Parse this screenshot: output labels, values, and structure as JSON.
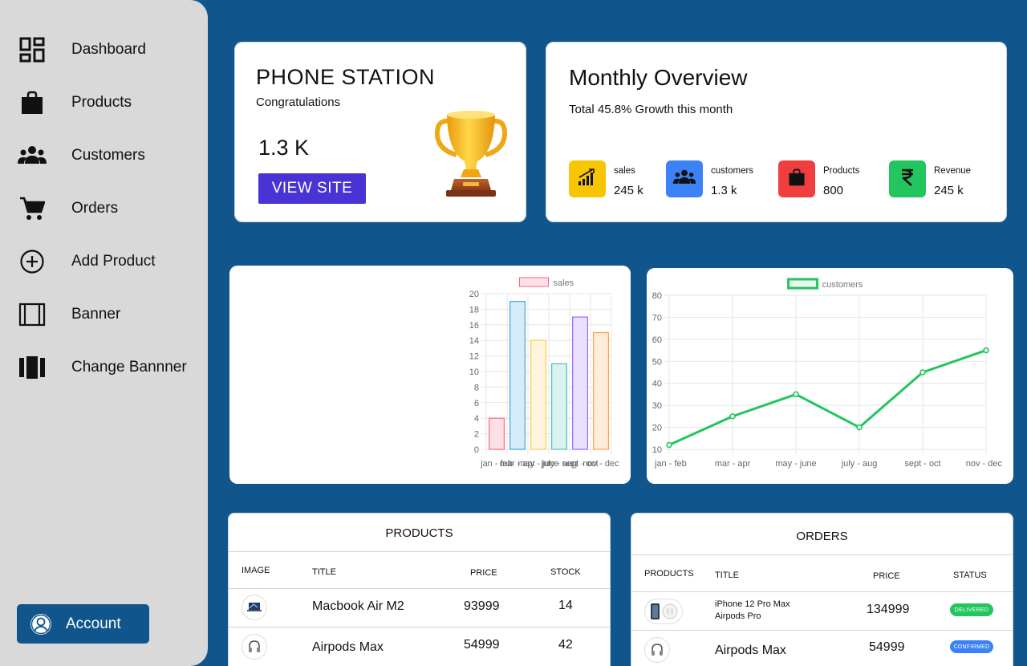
{
  "sidebar": {
    "items": [
      {
        "label": "Dashboard",
        "icon": "dashboard-icon"
      },
      {
        "label": "Products",
        "icon": "bag-icon"
      },
      {
        "label": "Customers",
        "icon": "users-icon"
      },
      {
        "label": "Orders",
        "icon": "cart-icon"
      },
      {
        "label": "Add Product",
        "icon": "plus-circle-icon"
      },
      {
        "label": "Banner",
        "icon": "banner-icon"
      },
      {
        "label": "Change Bannner",
        "icon": "change-banner-icon"
      }
    ],
    "account_label": "Account"
  },
  "welcome": {
    "title": "PHONE STATION",
    "subtitle": "Congratulations",
    "value": "1.3 K",
    "button_label": "VIEW SITE"
  },
  "overview": {
    "title": "Monthly Overview",
    "subtitle": "Total 45.8% Growth this month",
    "stats": [
      {
        "label": "sales",
        "value": "245 k",
        "color": "#f7c600",
        "icon": "signal-bars-icon"
      },
      {
        "label": "customers",
        "value": "1.3 k",
        "color": "#3b82f6",
        "icon": "users-icon"
      },
      {
        "label": "Products",
        "value": "800",
        "color": "#f03e3e",
        "icon": "bag-icon"
      },
      {
        "label": "Revenue",
        "value": "245 k",
        "color": "#22c55e",
        "icon": "rupee-icon"
      }
    ]
  },
  "chart_data": [
    {
      "type": "bar",
      "legend": "sales",
      "categories": [
        "jan - feb",
        "mar - apr",
        "may - june",
        "july - aug",
        "sept - oct",
        "nov - dec"
      ],
      "values": [
        4,
        19,
        14,
        11,
        17,
        15
      ],
      "ylim": [
        0,
        20
      ],
      "yticks": [
        0,
        2,
        4,
        6,
        8,
        10,
        12,
        14,
        16,
        18,
        20
      ],
      "fills": [
        "#ffe0e6",
        "#d7ecfb",
        "#fff4dc",
        "#dbf2f2",
        "#ebe0ff",
        "#ffecd9"
      ],
      "strokes": [
        "#ff6384",
        "#36a2eb",
        "#ffcd56",
        "#4bc0c0",
        "#9966ff",
        "#ff9f40"
      ],
      "grid": true,
      "legend_position": "top"
    },
    {
      "type": "line",
      "legend": "customers",
      "categories": [
        "jan - feb",
        "mar - apr",
        "may - june",
        "july - aug",
        "sept - oct",
        "nov - dec"
      ],
      "values": [
        12,
        25,
        35,
        20,
        45,
        55
      ],
      "ylim": [
        10,
        80
      ],
      "yticks": [
        10,
        20,
        30,
        40,
        50,
        60,
        70,
        80
      ],
      "color": "#22c55e",
      "grid": true,
      "legend_position": "top"
    }
  ],
  "products_table": {
    "title": "PRODUCTS",
    "headers": [
      "IMAGE",
      "TITLE",
      "PRICE",
      "STOCK"
    ],
    "rows": [
      {
        "title": "Macbook Air M2",
        "price": "93999",
        "stock": "14",
        "image_icon": "laptop-icon"
      },
      {
        "title": "Airpods Max",
        "price": "54999",
        "stock": "42",
        "image_icon": "headphones-icon"
      }
    ]
  },
  "orders_table": {
    "title": "ORDERS",
    "headers": [
      "PRODUCTS",
      "TITLE",
      "PRICE",
      "STATUS"
    ],
    "rows": [
      {
        "title_line1": "iPhone 12 Pro Max",
        "title_line2": "Airpods Pro",
        "price": "134999",
        "status": "DELIVERED",
        "status_color": "#22c55e"
      },
      {
        "title": "Airpods Max",
        "price": "54999",
        "status": "CONFIRMED",
        "status_color": "#3b82f6"
      }
    ]
  }
}
